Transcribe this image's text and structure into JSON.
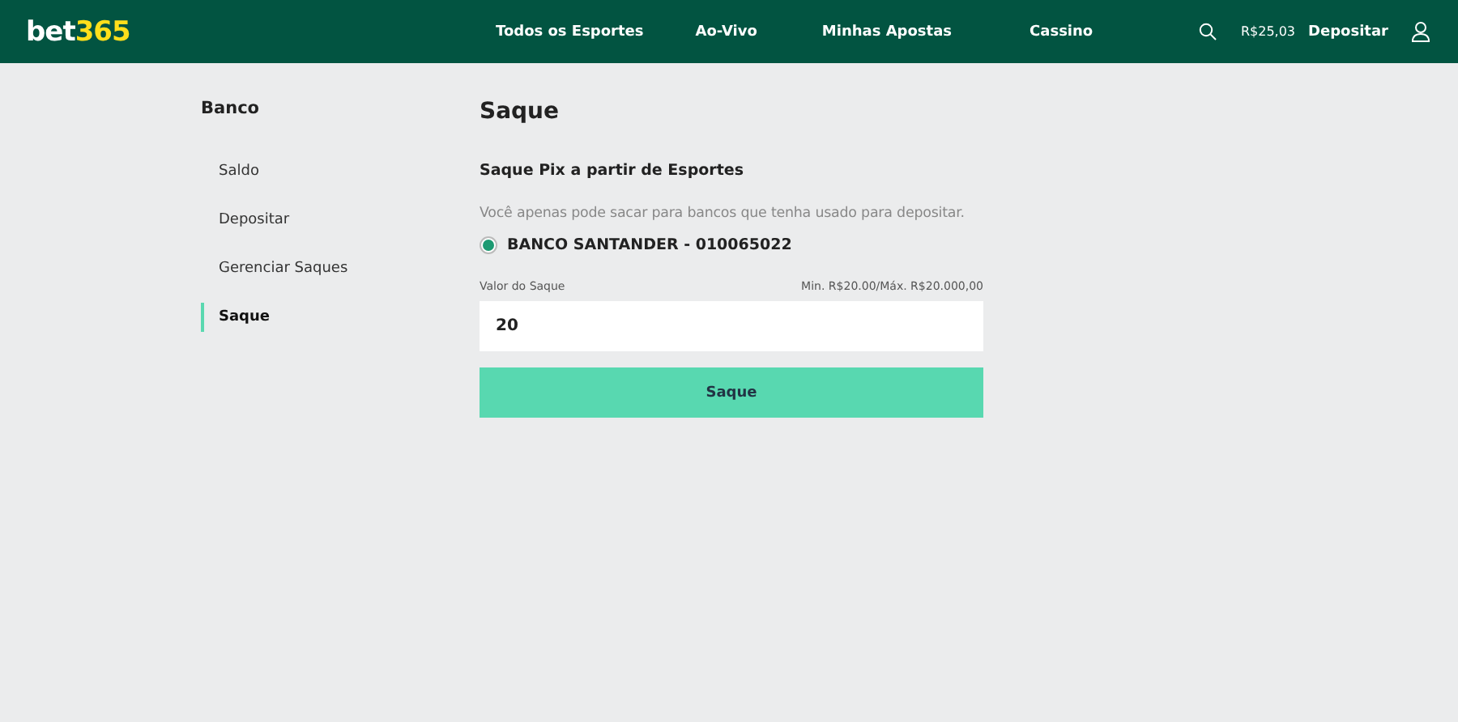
{
  "header": {
    "logo": {
      "part_1": "bet",
      "part_2": "365"
    },
    "nav": [
      {
        "label": "Todos os Esportes"
      },
      {
        "label": "Ao-Vivo"
      },
      {
        "label": "Minhas Apostas"
      },
      {
        "label": "Cassino"
      }
    ],
    "balance": "R$25,03",
    "deposit_link": "Depositar"
  },
  "sidebar": {
    "title": "Banco",
    "items": [
      {
        "label": "Saldo",
        "selected": false
      },
      {
        "label": "Depositar",
        "selected": false
      },
      {
        "label": "Gerenciar Saques",
        "selected": false
      },
      {
        "label": "Saque",
        "selected": true
      }
    ]
  },
  "main": {
    "title": "Saque",
    "subtitle": "Saque Pix a partir de Esportes",
    "note": "Você apenas pode sacar para bancos que tenha usado para depositar.",
    "banks": [
      {
        "label": "BANCO SANTANDER - 010065022",
        "selected": true
      }
    ],
    "amount_field": {
      "label": "Valor do Saque",
      "limits": "Min. R$20.00/Máx. R$20.000,00",
      "value": "20"
    },
    "submit_button": "Saque"
  }
}
